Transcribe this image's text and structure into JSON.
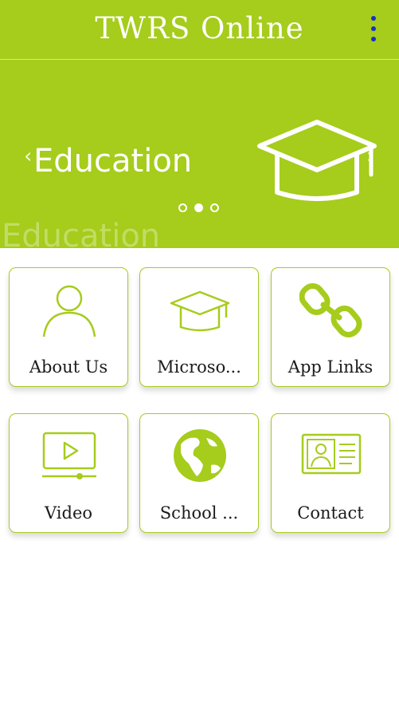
{
  "header": {
    "title": "TWRS Online",
    "menu_icon": "more-vertical-icon",
    "background": "#a6cc1c",
    "menu_color": "#1a2fc9"
  },
  "hero": {
    "title": "Education",
    "ghost_title": "Education",
    "prev_arrow": "‹",
    "next_arrow": "›",
    "icon": "graduation-cap-icon",
    "slide_count": 3,
    "active_slide": 2
  },
  "tiles": [
    {
      "label": "About Us",
      "icon": "person-icon"
    },
    {
      "label": "Microso...",
      "icon": "graduation-cap-icon"
    },
    {
      "label": "App Links",
      "icon": "chain-link-icon"
    },
    {
      "label": "Video",
      "icon": "video-player-icon"
    },
    {
      "label": "School ...",
      "icon": "globe-icon"
    },
    {
      "label": "Contact",
      "icon": "contact-card-icon"
    }
  ],
  "colors": {
    "accent": "#a6cc1c",
    "text": "#1b1b1b"
  }
}
